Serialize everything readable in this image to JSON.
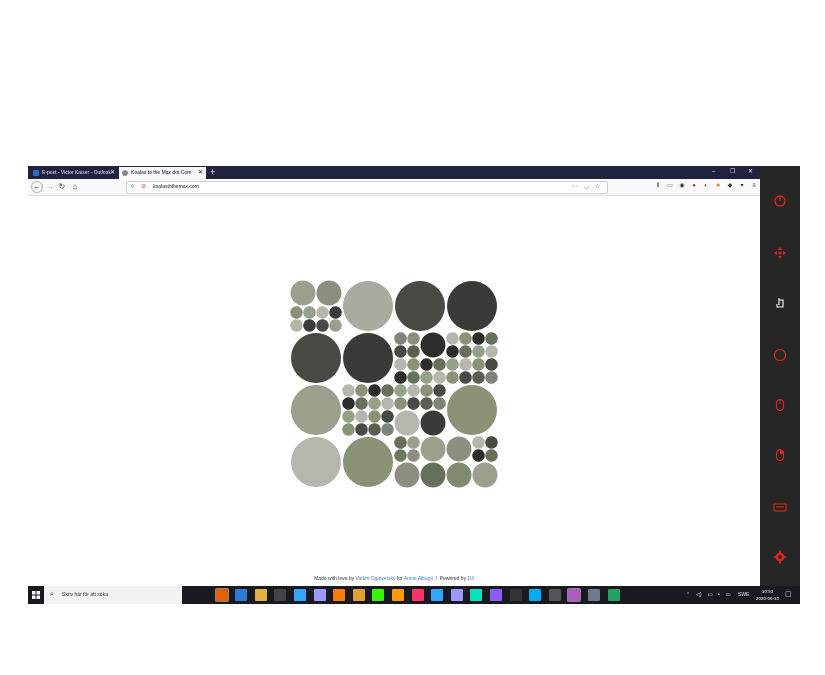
{
  "browser": {
    "tabs": [
      {
        "title": "E-post - Victor Kaiser - Outlook",
        "color": "#2b6cc4"
      },
      {
        "title": "Koalas to the Max dot Com",
        "color": "#888"
      }
    ],
    "new_tab": "+",
    "window_controls": [
      "–",
      "❐",
      "✕"
    ],
    "url": "koalastothemax.com",
    "nav_icons": [
      "back-icon",
      "forward-icon",
      "reload-icon",
      "home-icon"
    ]
  },
  "page": {
    "footer": {
      "made_with": "Made with love by",
      "author": "Vadim Ogievetsky",
      "for": "for",
      "recipient": "Annie Albagli",
      "sep": "/",
      "powered": "Powered by",
      "lib": "D3"
    }
  },
  "sidebar": {
    "icons": [
      "power-icon",
      "move-icon",
      "mouse-left-icon",
      "compass-icon",
      "mouse-icon",
      "mouse-right-icon",
      "keyboard-icon",
      "settings-gear-icon"
    ],
    "color": "#e0251b"
  },
  "taskbar": {
    "search_placeholder": "Skriv här för att söka",
    "lang": "SWE",
    "time": "10:50",
    "date": "2020-06-10"
  }
}
